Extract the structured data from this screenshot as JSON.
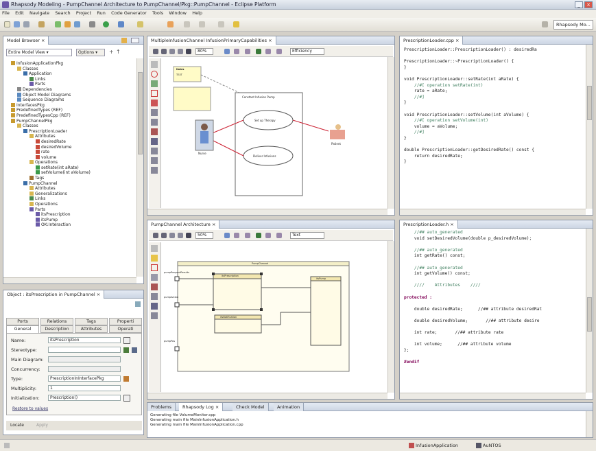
{
  "window": {
    "title": "Rhapsody Modeling - PumpChannel Architecture to PumpChannel/Pkg::PumpChannel - Eclipse Platform"
  },
  "menu": [
    "File",
    "Edit",
    "Navigate",
    "Search",
    "Project",
    "Run",
    "Code Generator",
    "Tools",
    "Window",
    "Help"
  ],
  "toolbar": {
    "perspective_label": "Rhapsody Mo..."
  },
  "model_browser": {
    "tab": "Model Browser",
    "view_select": "Entire Model View",
    "options_label": "Options",
    "tree": [
      {
        "label": "InfusionApplicationPkg",
        "depth": 1,
        "icon": "package-icon"
      },
      {
        "label": "Classes",
        "depth": 2,
        "icon": "folder-icon"
      },
      {
        "label": "Application",
        "depth": 3,
        "icon": "class-icon"
      },
      {
        "label": "Links",
        "depth": 4,
        "icon": "link-icon"
      },
      {
        "label": "Parts",
        "depth": 4,
        "icon": "part-icon"
      },
      {
        "label": "Dependencies",
        "depth": 2,
        "icon": "dependency-icon"
      },
      {
        "label": "Object Model Diagrams",
        "depth": 2,
        "icon": "diagram-icon"
      },
      {
        "label": "Sequence Diagrams",
        "depth": 2,
        "icon": "diagram-icon"
      },
      {
        "label": "InterfacesPkg",
        "depth": 1,
        "icon": "package-icon"
      },
      {
        "label": "PredefinedTypes (REF)",
        "depth": 1,
        "icon": "package-icon"
      },
      {
        "label": "PredefinedTypesCpp (REF)",
        "depth": 1,
        "icon": "package-icon"
      },
      {
        "label": "PumpChannelPkg",
        "depth": 1,
        "icon": "package-icon"
      },
      {
        "label": "Classes",
        "depth": 2,
        "icon": "folder-icon"
      },
      {
        "label": "PrescriptionLoader",
        "depth": 3,
        "icon": "class-icon"
      },
      {
        "label": "Attributes",
        "depth": 4,
        "icon": "folder-icon"
      },
      {
        "label": "desiredRate",
        "depth": 5,
        "icon": "attribute-icon"
      },
      {
        "label": "desiredVolume",
        "depth": 5,
        "icon": "attribute-icon"
      },
      {
        "label": "rate",
        "depth": 5,
        "icon": "attribute-icon"
      },
      {
        "label": "volume",
        "depth": 5,
        "icon": "attribute-icon"
      },
      {
        "label": "Operations",
        "depth": 4,
        "icon": "folder-icon"
      },
      {
        "label": "setRate(int aRate)",
        "depth": 5,
        "icon": "operation-icon"
      },
      {
        "label": "setVolume(int aVolume)",
        "depth": 5,
        "icon": "operation-icon"
      },
      {
        "label": "Tags",
        "depth": 4,
        "icon": "tag-icon"
      },
      {
        "label": "PumpChannel",
        "depth": 3,
        "icon": "class-icon"
      },
      {
        "label": "Attributes",
        "depth": 4,
        "icon": "folder-icon"
      },
      {
        "label": "Generalizations",
        "depth": 4,
        "icon": "folder-icon"
      },
      {
        "label": "Links",
        "depth": 4,
        "icon": "link-icon"
      },
      {
        "label": "Operations",
        "depth": 4,
        "icon": "folder-icon"
      },
      {
        "label": "Parts",
        "depth": 4,
        "icon": "part-icon"
      },
      {
        "label": "itsPrescription",
        "depth": 5,
        "icon": "part-icon"
      },
      {
        "label": "itsPump",
        "depth": 5,
        "icon": "part-icon"
      },
      {
        "label": "OK:Interaction",
        "depth": 5,
        "icon": "part-icon"
      }
    ]
  },
  "properties": {
    "tab": "Object : itsPrescription in PumpChannel",
    "tabs_row1": [
      "Ports",
      "Relations",
      "Tags",
      "Properti"
    ],
    "tabs_row2": [
      "General",
      "Description",
      "Attributes",
      "Operati"
    ],
    "fields": [
      {
        "label": "Name:",
        "value": "itsPrescription"
      },
      {
        "label": "Stereotype:",
        "value": ""
      },
      {
        "label": "Main Diagram:",
        "value": ""
      },
      {
        "label": "Concurrency:",
        "value": ""
      },
      {
        "label": "Type:",
        "value": "PrescriptionInInterfacePkg"
      },
      {
        "label": "Multiplicity:",
        "value": "1"
      },
      {
        "label": "Initialization:",
        "value": "Prescription()"
      }
    ],
    "restore_link": "Restore to values",
    "locate_button": "Locate",
    "apply_button": "Apply"
  },
  "use_case_diagram": {
    "tab": "MultipleInfusionChannel InfusionPrimaryCapabilities",
    "zoom": "80%",
    "filter": "Efficiency",
    "note_title": "Notes",
    "note_header": "TEXT",
    "boundary_title": "Constant Infusion Pump",
    "use_cases": [
      "Set up Therapy",
      "Deliver Infusions"
    ],
    "actors": [
      "Nurse",
      "Patient"
    ]
  },
  "architecture_diagram": {
    "tab": "PumpChannel Architecture",
    "zoom": "50%",
    "filter": "Text",
    "frame_title": "PumpChannel",
    "parts": [
      "itsPrescription",
      "itsPump",
      "itsNotification"
    ],
    "ports": [
      "pumpRequestResults",
      "pumpAction",
      "pumpPos"
    ]
  },
  "code_cpp": {
    "tab": "PrescriptionLoader.cpp",
    "lines": [
      {
        "t": "PrescriptionLoader::PrescriptionLoader() : desiredRa",
        "k": "n"
      },
      {
        "t": "",
        "k": "n"
      },
      {
        "t": "PrescriptionLoader::~PrescriptionLoader() {",
        "k": "n"
      },
      {
        "t": "}",
        "k": "n"
      },
      {
        "t": "",
        "k": "n"
      },
      {
        "t": "void PrescriptionLoader::setRate(int aRate) {",
        "k": "n"
      },
      {
        "t": "    //#[ operation setRate(int)",
        "k": "c"
      },
      {
        "t": "    rate = aRate;",
        "k": "n"
      },
      {
        "t": "    //#]",
        "k": "c"
      },
      {
        "t": "}",
        "k": "n"
      },
      {
        "t": "",
        "k": "n"
      },
      {
        "t": "void PrescriptionLoader::setVolume(int aVolume) {",
        "k": "n"
      },
      {
        "t": "    //#[ operation setVolume(int)",
        "k": "c"
      },
      {
        "t": "    volume = aVolume;",
        "k": "n"
      },
      {
        "t": "    //#]",
        "k": "c"
      },
      {
        "t": "}",
        "k": "n"
      },
      {
        "t": "",
        "k": "n"
      },
      {
        "t": "double PrescriptionLoader::getDesiredRate() const {",
        "k": "n"
      },
      {
        "t": "    return desiredRate;",
        "k": "n"
      },
      {
        "t": "}",
        "k": "n"
      }
    ]
  },
  "code_h": {
    "tab": "PrescriptionLoader.h",
    "lines": [
      {
        "t": "    //## auto_generated",
        "k": "c"
      },
      {
        "t": "    void setDesiredVolume(double p_desiredVolume);",
        "k": "n"
      },
      {
        "t": "",
        "k": "n"
      },
      {
        "t": "    //## auto_generated",
        "k": "c"
      },
      {
        "t": "    int getRate() const;",
        "k": "n"
      },
      {
        "t": "",
        "k": "n"
      },
      {
        "t": "    //## auto_generated",
        "k": "c"
      },
      {
        "t": "    int getVolume() const;",
        "k": "n"
      },
      {
        "t": "",
        "k": "n"
      },
      {
        "t": "    ////    Attributes    ////",
        "k": "c"
      },
      {
        "t": "",
        "k": "n"
      },
      {
        "t": "protected :",
        "k": "k"
      },
      {
        "t": "",
        "k": "n"
      },
      {
        "t": "    double desiredRate;      //## attribute desiredRat",
        "k": "n"
      },
      {
        "t": "",
        "k": "n"
      },
      {
        "t": "    double desiredVolume;       //## attribute desire",
        "k": "n"
      },
      {
        "t": "",
        "k": "n"
      },
      {
        "t": "    int rate;       //## attribute rate",
        "k": "n"
      },
      {
        "t": "",
        "k": "n"
      },
      {
        "t": "    int volume;      //## attribute volume",
        "k": "n"
      },
      {
        "t": "};",
        "k": "n"
      },
      {
        "t": "",
        "k": "n"
      },
      {
        "t": "#endif",
        "k": "k"
      }
    ]
  },
  "bottom_panel": {
    "tabs": [
      "Problems",
      "Rhapsody Log",
      "Check Model",
      "Animation"
    ],
    "log": [
      "Generating file VolumeMonitor.cpp",
      "Generating main file MainInfusionApplication.h",
      "Generating main file MainInfusionApplication.cpp"
    ]
  },
  "status": {
    "left": "",
    "project": "InfusionApplication",
    "config": "AuNTOS"
  }
}
